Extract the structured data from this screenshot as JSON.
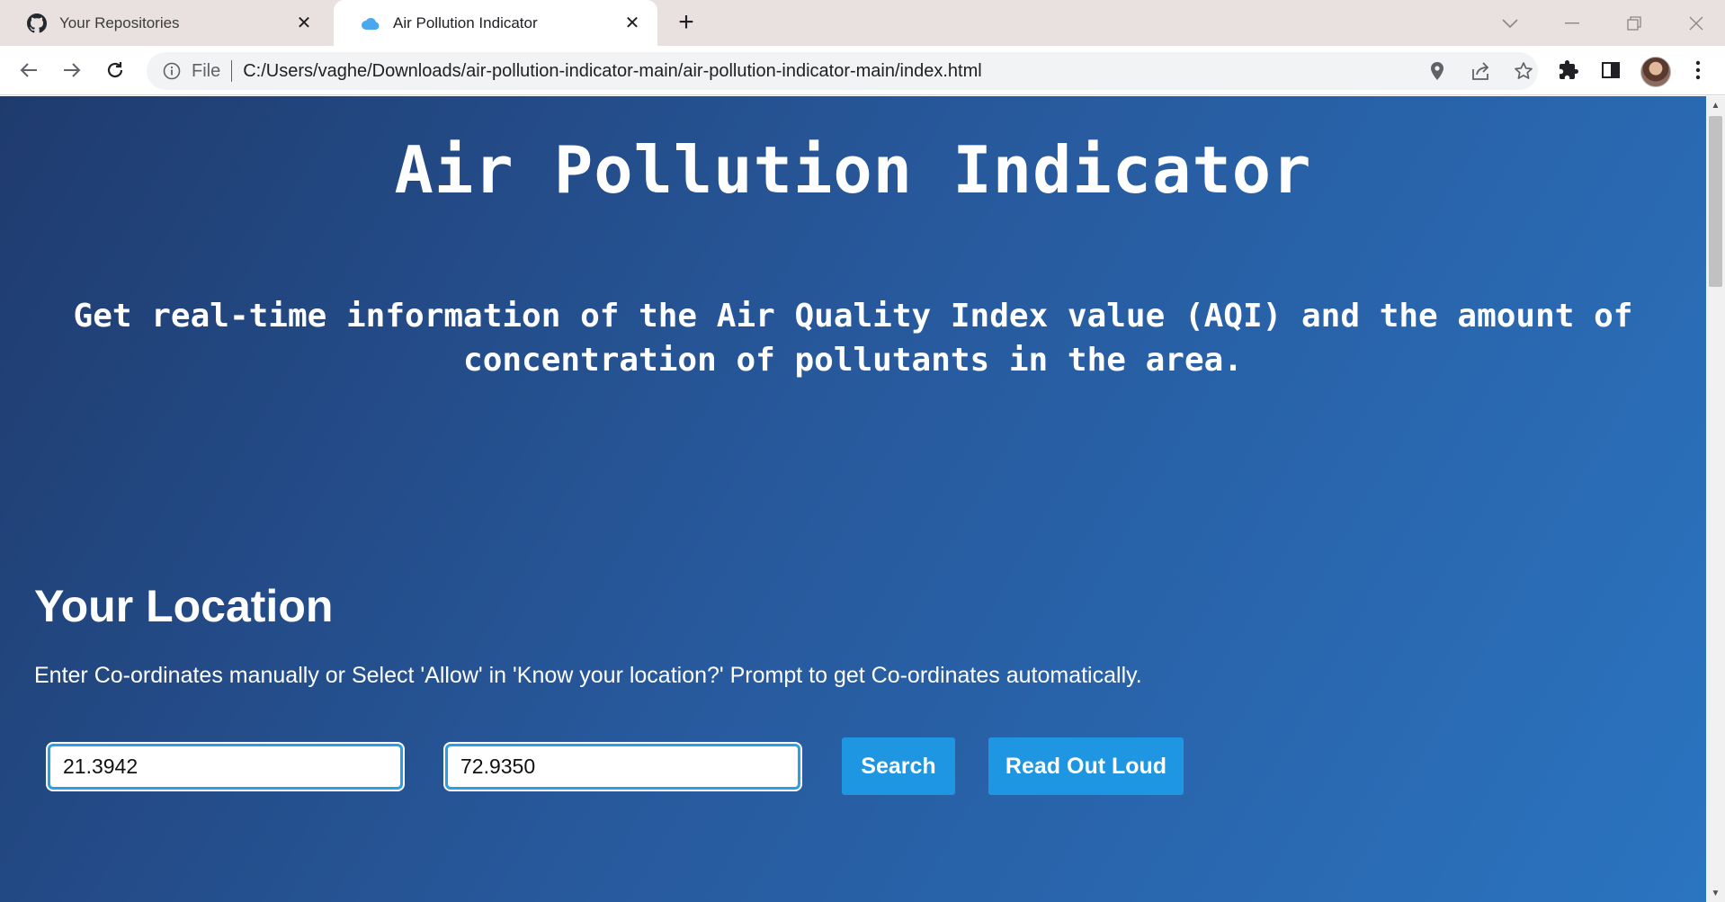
{
  "browser": {
    "tabs": [
      {
        "title": "Your Repositories",
        "icon": "github-icon",
        "active": false
      },
      {
        "title": "Air Pollution Indicator",
        "icon": "cloud-icon",
        "active": true
      }
    ],
    "address_bar": {
      "scheme_label": "File",
      "url": "C:/Users/vaghe/Downloads/air-pollution-indicator-main/air-pollution-indicator-main/index.html"
    }
  },
  "page": {
    "title": "Air Pollution Indicator",
    "subtitle_line1": "Get real-time information of the Air Quality Index value (AQI) and the amount of",
    "subtitle_line2": "concentration of pollutants in the area.",
    "location_heading": "Your Location",
    "location_description": "Enter Co-ordinates manually or Select 'Allow' in 'Know your location?' Prompt to get Co-ordinates automatically.",
    "latitude_value": "21.3942",
    "longitude_value": "72.9350",
    "search_label": "Search",
    "read_out_loud_label": "Read Out Loud"
  },
  "colors": {
    "background_gradient": [
      "#1f3b6e",
      "#2b74c0"
    ],
    "button": "#1f96e2",
    "input_border": "#2a9ee6"
  }
}
